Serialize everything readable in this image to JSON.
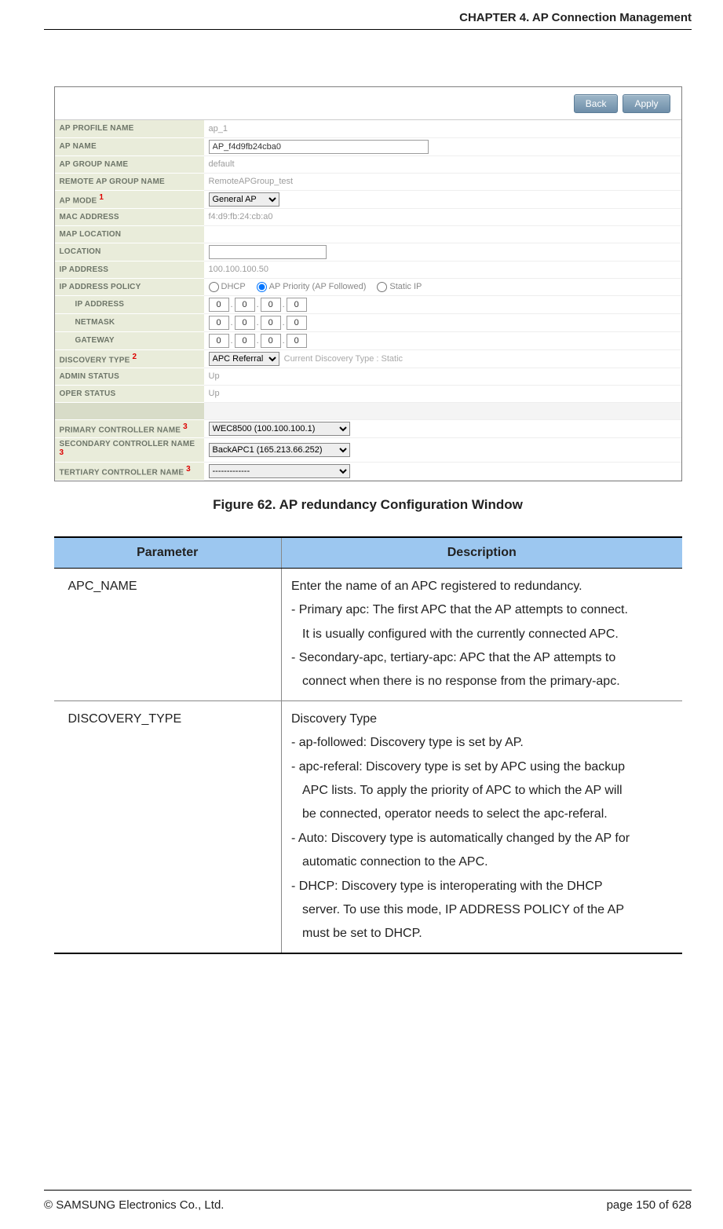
{
  "header": {
    "chapter": "CHAPTER 4. AP Connection Management"
  },
  "screenshot": {
    "buttons": {
      "back": "Back",
      "apply": "Apply"
    },
    "rows": {
      "ap_profile_name": {
        "label": "AP PROFILE NAME",
        "value": "ap_1"
      },
      "ap_name": {
        "label": "AP NAME",
        "value": "AP_f4d9fb24cba0"
      },
      "ap_group_name": {
        "label": "AP GROUP NAME",
        "value": "default"
      },
      "remote_ap_group_name": {
        "label": "REMOTE AP GROUP NAME",
        "value": "RemoteAPGroup_test"
      },
      "ap_mode": {
        "label": "AP MODE",
        "note": "1",
        "value": "General AP"
      },
      "mac_address": {
        "label": "MAC ADDRESS",
        "value": "f4:d9:fb:24:cb:a0"
      },
      "map_location": {
        "label": "MAP LOCATION",
        "value": ""
      },
      "location": {
        "label": "LOCATION",
        "value": ""
      },
      "ip_address_ro": {
        "label": "IP ADDRESS",
        "value": "100.100.100.50"
      },
      "ip_policy": {
        "label": "IP ADDRESS POLICY",
        "opts": {
          "dhcp": "DHCP",
          "ap_priority": "AP Priority (AP Followed)",
          "static": "Static IP"
        },
        "selected": "ap_priority"
      },
      "ip_sub": {
        "ip": {
          "label": "IP ADDRESS",
          "o": [
            "0",
            "0",
            "0",
            "0"
          ]
        },
        "netmask": {
          "label": "NETMASK",
          "o": [
            "0",
            "0",
            "0",
            "0"
          ]
        },
        "gateway": {
          "label": "GATEWAY",
          "o": [
            "0",
            "0",
            "0",
            "0"
          ]
        }
      },
      "discovery_type": {
        "label": "DISCOVERY TYPE",
        "note": "2",
        "value": "APC Referral",
        "hint": "Current Discovery Type : Static"
      },
      "admin_status": {
        "label": "ADMIN STATUS",
        "value": "Up"
      },
      "oper_status": {
        "label": "OPER STATUS",
        "value": "Up"
      },
      "primary_ctrl": {
        "label": "PRIMARY CONTROLLER NAME",
        "note": "3",
        "value": "WEC8500 (100.100.100.1)"
      },
      "secondary_ctrl": {
        "label": "SECONDARY CONTROLLER NAME",
        "note": "3",
        "value": "BackAPC1 (165.213.66.252)"
      },
      "tertiary_ctrl": {
        "label": "TERTIARY CONTROLLER NAME",
        "note": "3",
        "value": "-------------"
      }
    }
  },
  "caption": "Figure 62. AP redundancy Configuration Window",
  "table": {
    "headers": {
      "param": "Parameter",
      "desc": "Description"
    },
    "rows": [
      {
        "param": "APC_NAME",
        "desc": {
          "line1": "Enter the name of an APC registered to redundancy.",
          "line2": "- Primary apc: The first APC that the AP attempts to connect.",
          "line3": "It is usually configured with the currently connected APC.",
          "line4": "- Secondary-apc, tertiary-apc: APC that the AP attempts to",
          "line5": "connect when there is no response from the primary-apc."
        }
      },
      {
        "param": "DISCOVERY_TYPE",
        "desc": {
          "line1": "Discovery Type",
          "line2": "- ap-followed: Discovery type is set by AP.",
          "line3": "- apc-referal: Discovery type is set by APC using the backup",
          "line4": "APC lists. To apply the priority of APC to which the AP will",
          "line5": "be connected, operator needs to select the apc-referal.",
          "line6": "- Auto: Discovery type is automatically changed by the AP for",
          "line7": "automatic connection to the APC.",
          "line8": "- DHCP: Discovery type is interoperating with the DHCP",
          "line9": "server. To use this mode, IP ADDRESS POLICY of the AP",
          "line10": "must be set to DHCP."
        }
      }
    ]
  },
  "footer": {
    "copyright": "©  SAMSUNG Electronics Co., Ltd.",
    "page": "page 150 of 628"
  }
}
